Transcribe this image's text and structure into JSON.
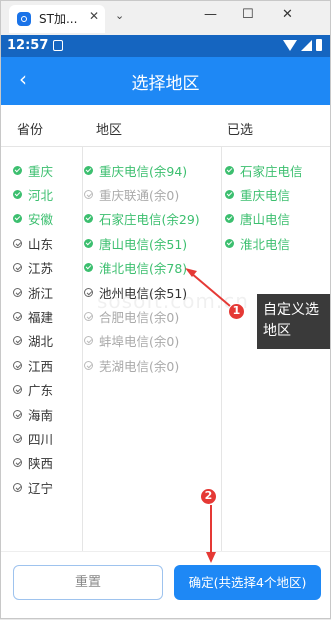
{
  "window": {
    "tab_title": "ST加...",
    "close_glyph": "✕",
    "chevron_glyph": "⌄",
    "min_glyph": "—",
    "max_glyph": "☐",
    "winclose_glyph": "✕"
  },
  "status": {
    "time": "12:57"
  },
  "header": {
    "back_glyph": "‹",
    "title": "选择地区"
  },
  "columns": {
    "province": "省份",
    "region": "地区",
    "selected": "已选"
  },
  "provinces": [
    {
      "label": "重庆",
      "state": "on"
    },
    {
      "label": "河北",
      "state": "on"
    },
    {
      "label": "安徽",
      "state": "on"
    },
    {
      "label": "山东",
      "state": "off"
    },
    {
      "label": "江苏",
      "state": "off"
    },
    {
      "label": "浙江",
      "state": "off"
    },
    {
      "label": "福建",
      "state": "off"
    },
    {
      "label": "湖北",
      "state": "off"
    },
    {
      "label": "江西",
      "state": "off"
    },
    {
      "label": "广东",
      "state": "off"
    },
    {
      "label": "海南",
      "state": "off"
    },
    {
      "label": "四川",
      "state": "off"
    },
    {
      "label": "陕西",
      "state": "off"
    },
    {
      "label": "辽宁",
      "state": "off"
    }
  ],
  "regions": [
    {
      "label": "重庆电信(余94)",
      "state": "on"
    },
    {
      "label": "重庆联通(余0)",
      "state": "dis"
    },
    {
      "label": "石家庄电信(余29)",
      "state": "on"
    },
    {
      "label": "唐山电信(余51)",
      "state": "on"
    },
    {
      "label": "淮北电信(余78)",
      "state": "on"
    },
    {
      "label": "池州电信(余51)",
      "state": "off"
    },
    {
      "label": "合肥电信(余0)",
      "state": "dis"
    },
    {
      "label": "蚌埠电信(余0)",
      "state": "dis"
    },
    {
      "label": "芜湖电信(余0)",
      "state": "dis"
    }
  ],
  "selected": [
    {
      "label": "石家庄电信",
      "state": "on"
    },
    {
      "label": "重庆电信",
      "state": "on"
    },
    {
      "label": "唐山电信",
      "state": "on"
    },
    {
      "label": "淮北电信",
      "state": "on"
    }
  ],
  "footer": {
    "reset_label": "重置",
    "confirm_label": "确定(共选择4个地区)"
  },
  "annotations": {
    "badge1": "1",
    "badge2": "2",
    "callout_line1": "自定义选",
    "callout_line2": "地区"
  },
  "watermark": "sosoft.com.cn",
  "colors": {
    "primary": "#1e88f5",
    "checked": "#3cbf6f",
    "annotation": "#e53935"
  }
}
